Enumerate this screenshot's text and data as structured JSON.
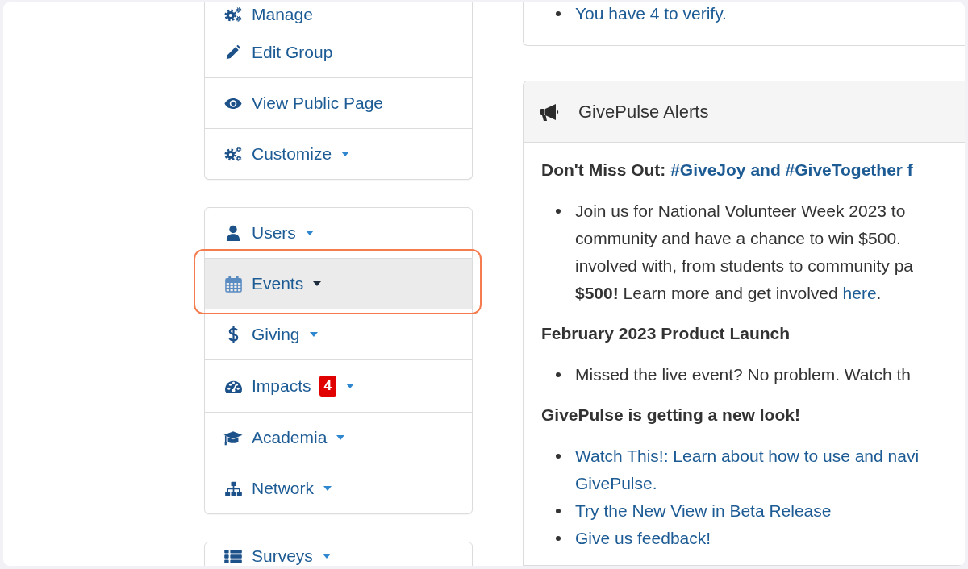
{
  "sidebar": {
    "groups": [
      {
        "items": [
          {
            "label": "Manage",
            "dropdown": false,
            "selected": false
          },
          {
            "label": "Edit Group",
            "dropdown": false,
            "selected": false
          },
          {
            "label": "View Public Page",
            "dropdown": false,
            "selected": false
          },
          {
            "label": "Customize",
            "dropdown": true,
            "selected": false
          }
        ]
      },
      {
        "items": [
          {
            "label": "Users",
            "dropdown": true,
            "selected": false
          },
          {
            "label": "Events",
            "dropdown": true,
            "selected": true
          },
          {
            "label": "Giving",
            "dropdown": true,
            "selected": false
          },
          {
            "label": "Impacts",
            "badge": "4",
            "dropdown": true,
            "selected": false
          },
          {
            "label": "Academia",
            "dropdown": true,
            "selected": false
          },
          {
            "label": "Network",
            "dropdown": true,
            "selected": false
          }
        ]
      },
      {
        "items": [
          {
            "label": "Surveys",
            "dropdown": true,
            "selected": false
          }
        ]
      }
    ]
  },
  "verify_panel": {
    "links": [
      "You have 4 to verify."
    ]
  },
  "alerts_panel": {
    "title": "GivePulse Alerts",
    "sections": [
      {
        "heading": "Don't Miss Out: ",
        "heading_link": "#GiveJoy and #GiveTogether f",
        "bullets": [
          {
            "kind": "text",
            "lines": [
              "Join us for National Volunteer Week 2023 to",
              "community and have a chance to win $500.",
              "involved with, from students to community pa",
              "**$500!** Learn more and get involved "
            ],
            "link": "here",
            "after_link": "."
          }
        ]
      },
      {
        "heading": "February 2023 Product Launch",
        "bullets": [
          {
            "kind": "text",
            "lines": [
              "Missed the live event? No problem. Watch th"
            ]
          }
        ]
      },
      {
        "heading": "GivePulse is getting a new look!",
        "bullets": [
          {
            "kind": "link",
            "lines": [
              "Watch This!: Learn about how to use and navi",
              "GivePulse."
            ]
          },
          {
            "kind": "link",
            "lines": [
              "Try the New View in Beta Release"
            ]
          },
          {
            "kind": "link",
            "lines": [
              "Give us feedback!"
            ]
          }
        ]
      }
    ]
  }
}
